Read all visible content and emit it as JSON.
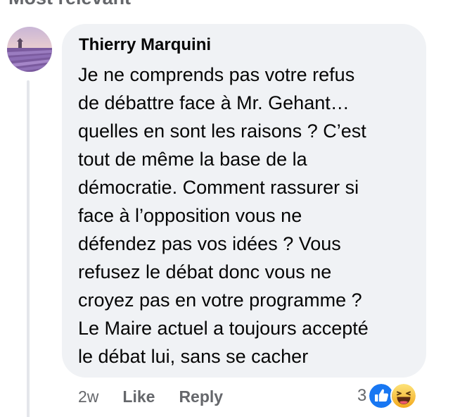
{
  "header": {
    "sort_label": "Most relevant",
    "chevron_icon": "chevron-down-icon"
  },
  "comment": {
    "avatar_icon": "avatar",
    "author": "Thierry Marquini",
    "text": "Je ne comprends pas votre refus\nde débattre face à Mr. Gehant…\nquelles en sont les raisons ? C’est\ntout de même la base de la\ndémocratie. Comment rassurer si\nface à l’opposition vous ne\ndéfendez pas vos idées ? Vous\nrefusez le débat donc vous ne\ncroyez pas en votre programme ?\nLe Maire actuel a toujours accepté\nle débat lui, sans se cacher",
    "timestamp": "2w",
    "like_label": "Like",
    "reply_label": "Reply",
    "reaction_count": "3",
    "reactions": [
      "like-reaction-icon",
      "haha-reaction-icon"
    ]
  },
  "colors": {
    "bubble_bg": "#f0f2f5",
    "meta_text": "#65676b",
    "body_text": "#050505",
    "like_blue": "#1877f2",
    "haha_yellow": "#f7b928"
  }
}
